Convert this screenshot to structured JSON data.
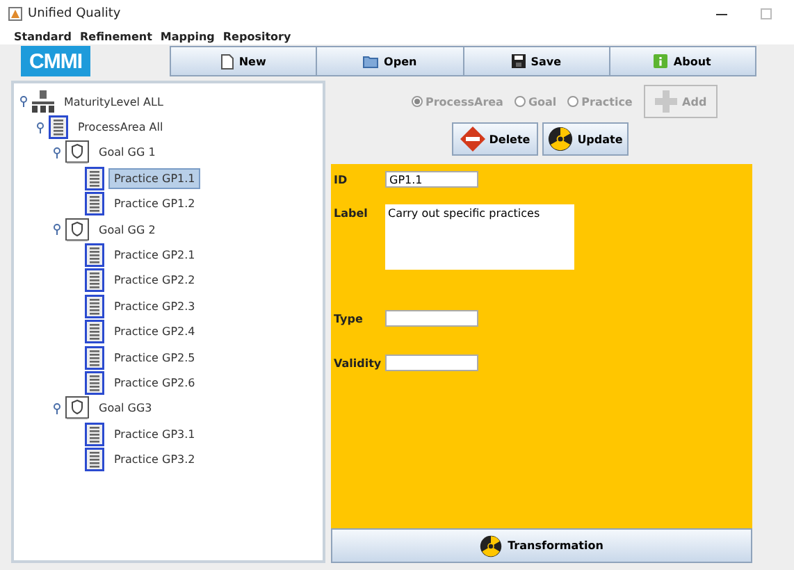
{
  "window": {
    "title": "Unified Quality"
  },
  "menu": [
    "Standard",
    "Refinement",
    "Mapping",
    "Repository"
  ],
  "logo": "CMMI",
  "toolbar": [
    {
      "label": "New",
      "kind": "new"
    },
    {
      "label": "Open",
      "kind": "open"
    },
    {
      "label": "Save",
      "kind": "save"
    },
    {
      "label": "About",
      "kind": "about"
    }
  ],
  "tree": [
    {
      "label": "MaturityLevel  ALL",
      "kind": "level",
      "expanded": true,
      "selected": false,
      "children": [
        {
          "label": "ProcessArea All",
          "kind": "area",
          "expanded": true,
          "selected": false,
          "children": [
            {
              "label": "Goal GG 1",
              "kind": "goal",
              "expanded": true,
              "selected": false,
              "children": [
                {
                  "label": "Practice GP1.1",
                  "kind": "practice",
                  "selected": true
                },
                {
                  "label": "Practice GP1.2",
                  "kind": "practice",
                  "selected": false
                }
              ]
            },
            {
              "label": "Goal GG 2",
              "kind": "goal",
              "expanded": true,
              "selected": false,
              "children": [
                {
                  "label": "Practice GP2.1",
                  "kind": "practice",
                  "selected": false
                },
                {
                  "label": "Practice GP2.2",
                  "kind": "practice",
                  "selected": false
                },
                {
                  "label": "Practice GP2.3",
                  "kind": "practice",
                  "selected": false
                },
                {
                  "label": "Practice GP2.4",
                  "kind": "practice",
                  "selected": false
                },
                {
                  "label": "Practice GP2.5",
                  "kind": "practice",
                  "selected": false
                },
                {
                  "label": "Practice GP2.6",
                  "kind": "practice",
                  "selected": false
                }
              ]
            },
            {
              "label": "Goal GG3",
              "kind": "goal",
              "expanded": true,
              "selected": false,
              "children": [
                {
                  "label": "Practice GP3.1",
                  "kind": "practice",
                  "selected": false
                },
                {
                  "label": "Practice GP3.2",
                  "kind": "practice",
                  "selected": false
                }
              ]
            }
          ]
        }
      ]
    }
  ],
  "radios": [
    {
      "label": "ProcessArea",
      "selected": true,
      "disabled": true
    },
    {
      "label": "Goal",
      "selected": false,
      "disabled": true
    },
    {
      "label": "Practice",
      "selected": false,
      "disabled": true
    }
  ],
  "add_button": {
    "label": "Add",
    "disabled": true
  },
  "actions": [
    {
      "label": "Delete",
      "kind": "delete"
    },
    {
      "label": "Update",
      "kind": "update"
    }
  ],
  "form": [
    {
      "label": "ID",
      "value": "GP1.1",
      "kind": "line"
    },
    {
      "label": "Label",
      "value": "Carry out specific practices",
      "kind": "area"
    },
    {
      "label": "Type",
      "kind": "line"
    },
    {
      "label": "Validity",
      "kind": "line"
    }
  ],
  "transform_button": {
    "label": "Transformation"
  }
}
